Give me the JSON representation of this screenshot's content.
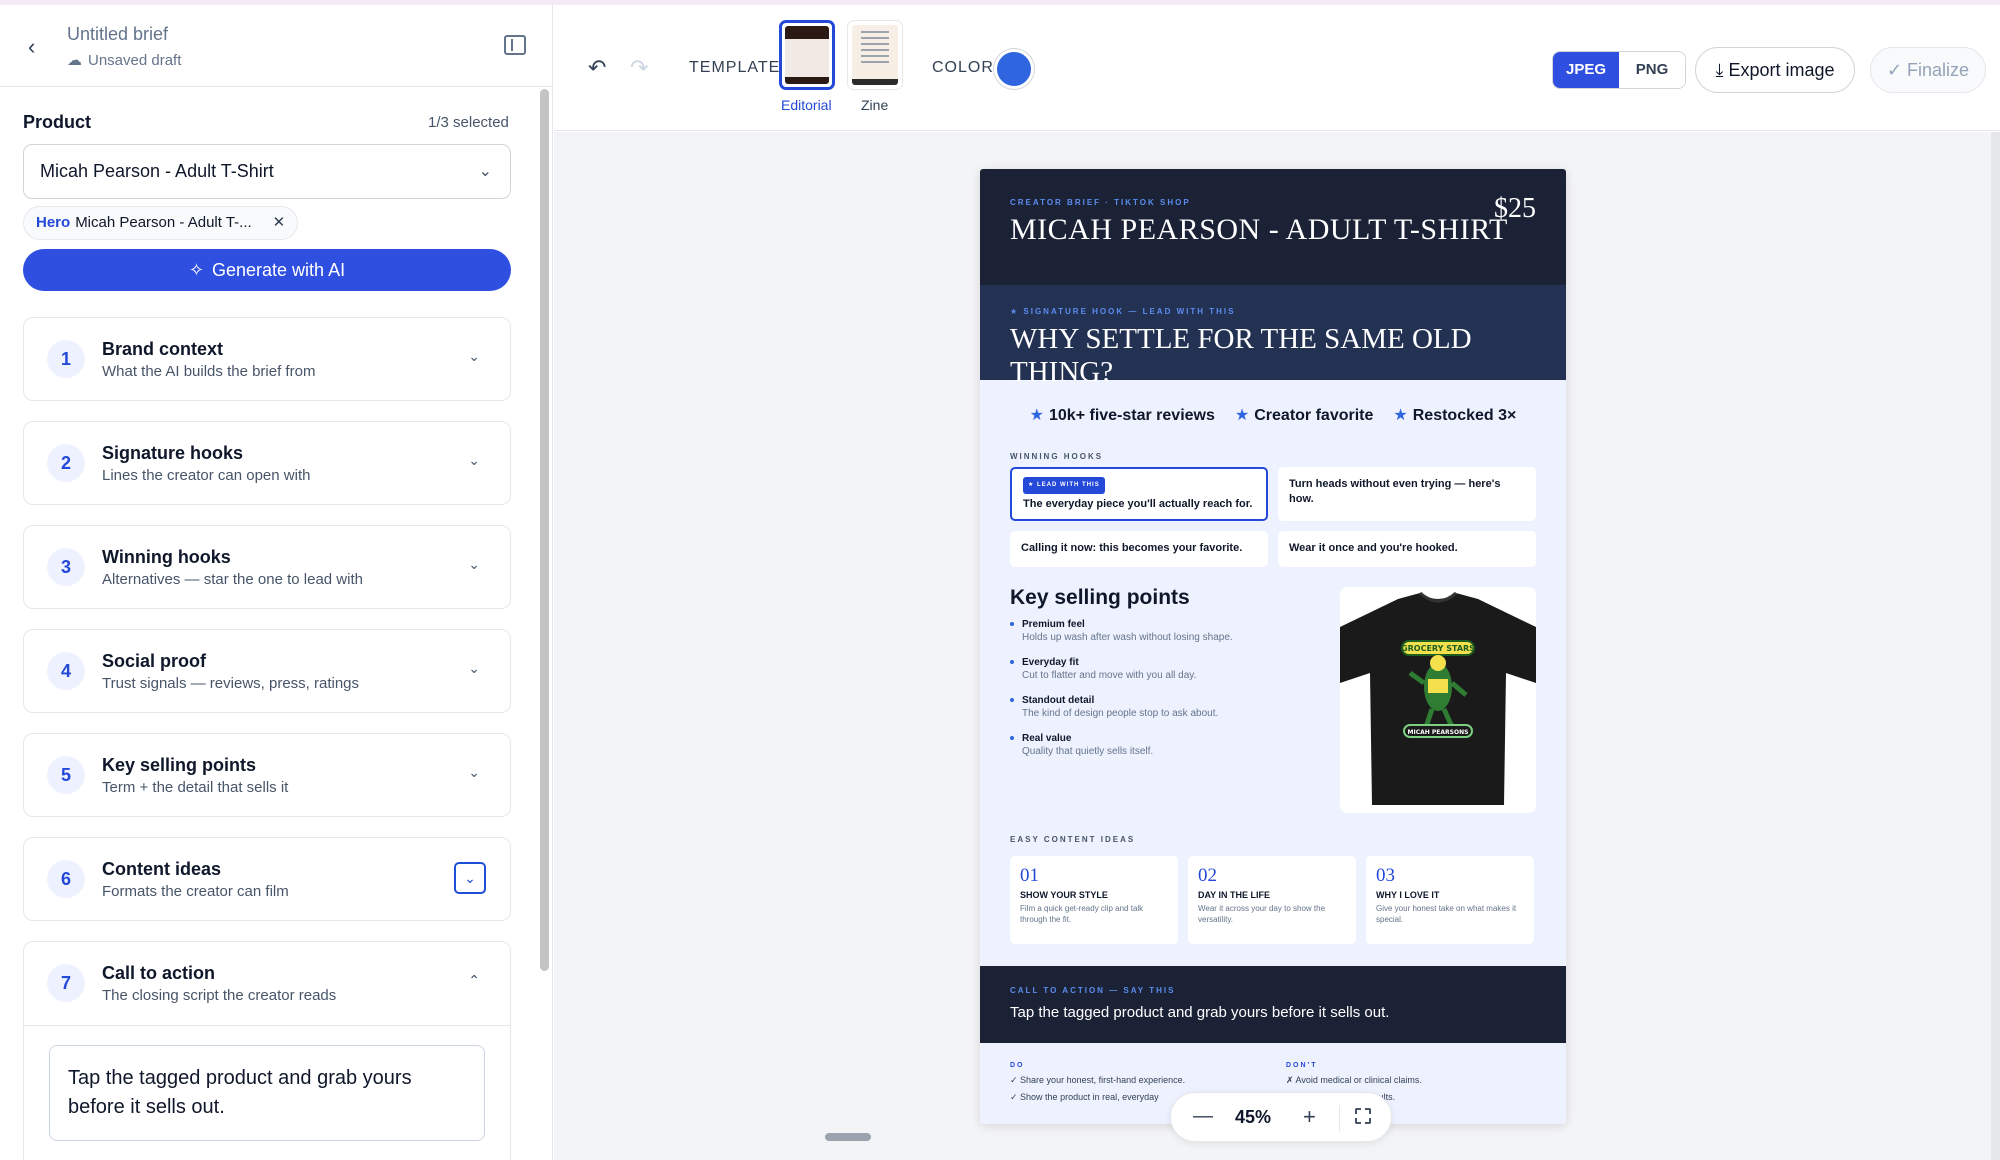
{
  "header": {
    "doc_title": "Untitled brief",
    "doc_status": "Unsaved draft"
  },
  "product": {
    "label": "Product",
    "selected_count": "1/3 selected",
    "select_value": "Micah Pearson - Adult T-Shirt",
    "chip_badge": "Hero",
    "chip_label": "Micah Pearson - Adult T-...",
    "generate_label": "Generate with AI"
  },
  "sections": [
    {
      "num": "1",
      "title": "Brand context",
      "sub": "What the AI builds the brief from"
    },
    {
      "num": "2",
      "title": "Signature hooks",
      "sub": "Lines the creator can open with"
    },
    {
      "num": "3",
      "title": "Winning hooks",
      "sub": "Alternatives — star the one to lead with"
    },
    {
      "num": "4",
      "title": "Social proof",
      "sub": "Trust signals — reviews, press, ratings"
    },
    {
      "num": "5",
      "title": "Key selling points",
      "sub": "Term + the detail that sells it"
    },
    {
      "num": "6",
      "title": "Content ideas",
      "sub": "Formats the creator can film"
    },
    {
      "num": "7",
      "title": "Call to action",
      "sub": "The closing script the creator reads",
      "text": "Tap the tagged product and grab yours before it sells out."
    }
  ],
  "toolbar": {
    "template_label": "TEMPLATE",
    "templates": [
      "Editorial",
      "Zine"
    ],
    "color_label": "COLOR",
    "color_value": "#2f66e0",
    "formats": [
      "JPEG",
      "PNG"
    ],
    "export_label": "Export image",
    "finalize_label": "Finalize"
  },
  "brief": {
    "eyebrow": "CREATOR BRIEF · TIKTOK SHOP",
    "title": "MICAH PEARSON - ADULT T-SHIRT",
    "price": "$25",
    "hook_eyebrow": "★ SIGNATURE HOOK — LEAD WITH THIS",
    "hook": "WHY SETTLE FOR THE SAME OLD THING?",
    "proof": [
      "10k+ five-star reviews",
      "Creator favorite",
      "Restocked 3×"
    ],
    "winning_label": "WINNING HOOKS",
    "lead_badge": "★ LEAD WITH THIS",
    "hooks": [
      "The everyday piece you'll actually reach for.",
      "Turn heads without even trying — here's how.",
      "Calling it now: this becomes your favorite.",
      "Wear it once and you're hooked."
    ],
    "ksp_title": "Key selling points",
    "ksp": [
      {
        "term": "Premium feel",
        "detail": "Holds up wash after wash without losing shape."
      },
      {
        "term": "Everyday fit",
        "detail": "Cut to flatter and move with you all day."
      },
      {
        "term": "Standout detail",
        "detail": "The kind of design people stop to ask about."
      },
      {
        "term": "Real value",
        "detail": "Quality that quietly sells itself."
      }
    ],
    "shirt_top_text": "GROCERY STARS",
    "shirt_bottom_text": "MICAH PEARSONS",
    "ideas_label": "EASY CONTENT IDEAS",
    "ideas": [
      {
        "num": "01",
        "title": "SHOW YOUR STYLE",
        "body": "Film a quick get-ready clip and talk through the fit."
      },
      {
        "num": "02",
        "title": "DAY IN THE LIFE",
        "body": "Wear it across your day to show the versatility."
      },
      {
        "num": "03",
        "title": "WHY I LOVE IT",
        "body": "Give your honest take on what makes it special."
      }
    ],
    "cta_eyebrow": "CALL TO ACTION — SAY THIS",
    "cta": "Tap the tagged product and grab yours before it sells out.",
    "do_label": "DO",
    "do": [
      "✓ Share your honest, first-hand experience.",
      "✓ Show the product in real, everyday"
    ],
    "dont_label": "DON'T",
    "dont": [
      "✗ Avoid medical or clinical claims.",
      "✗ … or guaranteed results."
    ]
  },
  "zoom": {
    "value": "45%"
  }
}
